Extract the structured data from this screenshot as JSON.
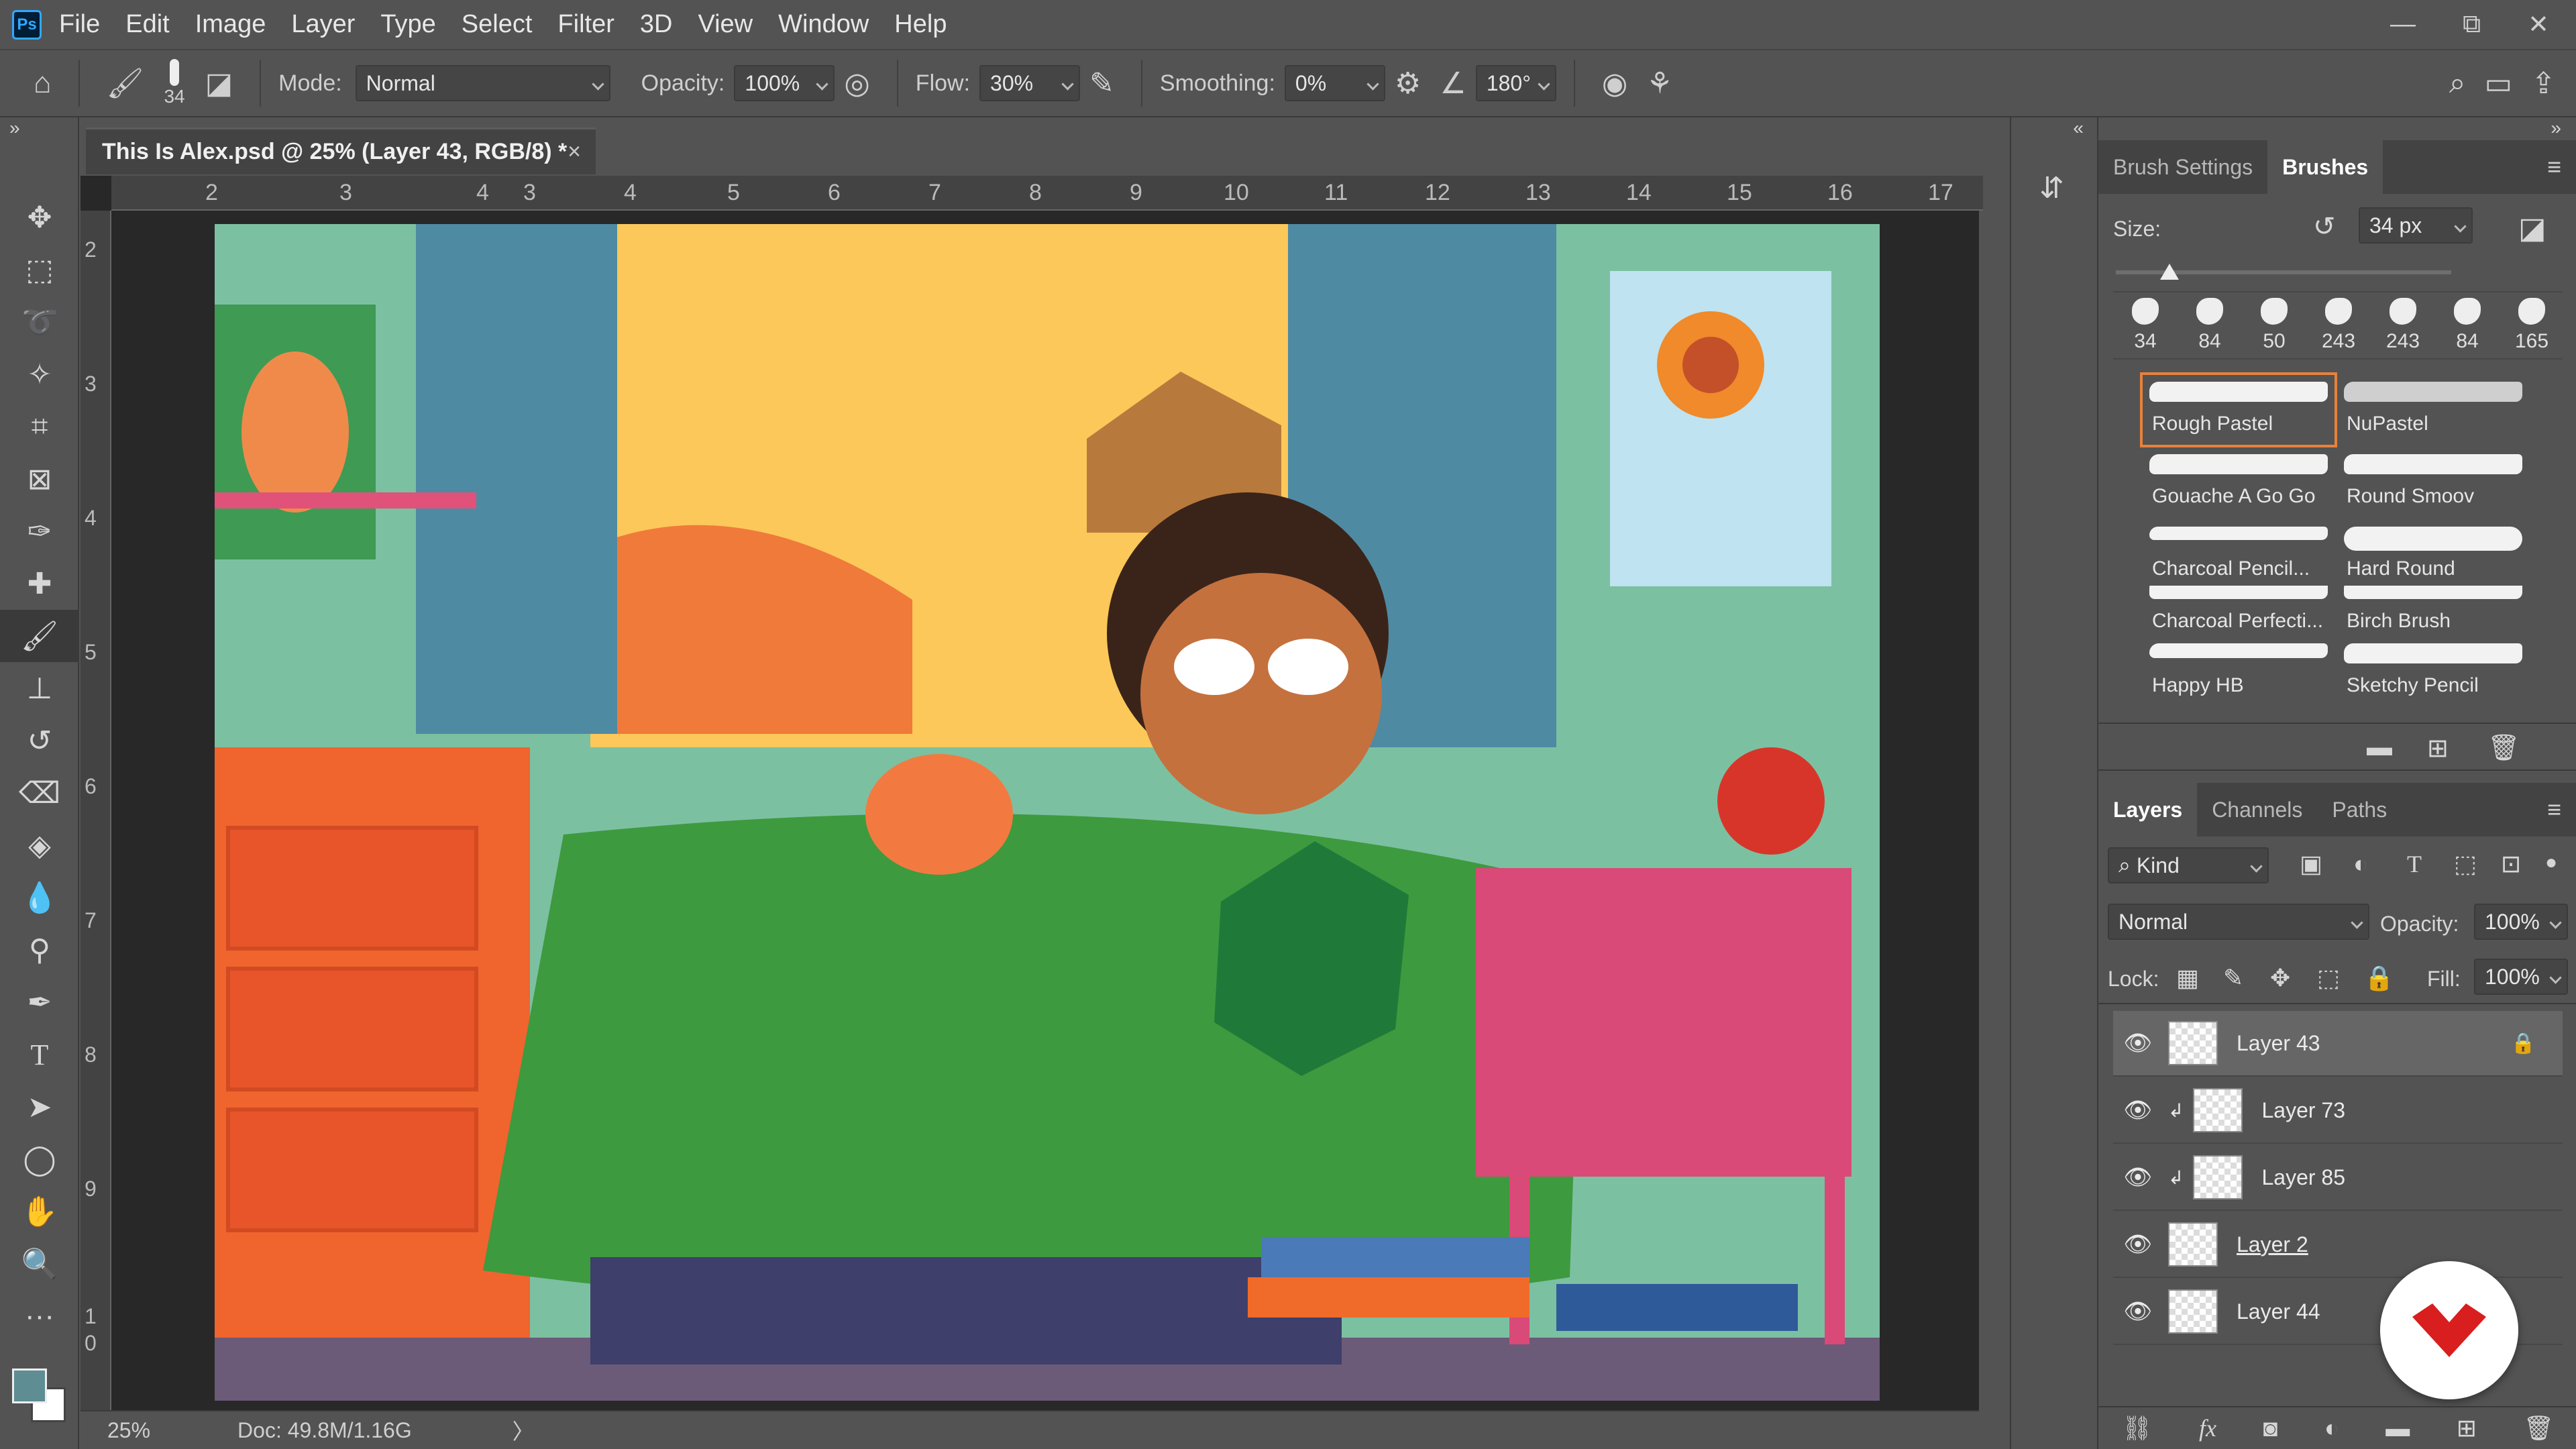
{
  "app": {
    "logo": "Ps",
    "menus": [
      "File",
      "Edit",
      "Image",
      "Layer",
      "Type",
      "Select",
      "Filter",
      "3D",
      "View",
      "Window",
      "Help"
    ]
  },
  "window_controls": {
    "minimize": "—",
    "restore": "⧉",
    "close": "✕"
  },
  "options_bar": {
    "brush_size": "34",
    "mode_label": "Mode:",
    "mode_value": "Normal",
    "opacity_label": "Opacity:",
    "opacity_value": "100%",
    "flow_label": "Flow:",
    "flow_value": "30%",
    "smoothing_label": "Smoothing:",
    "smoothing_value": "0%",
    "angle_value": "180°"
  },
  "document": {
    "tab_title": "This Is Alex.psd @ 25% (Layer 43, RGB/8) *",
    "close": "×"
  },
  "ruler": {
    "top_ticks": [
      "2",
      "3",
      "4",
      "3",
      "4",
      "5",
      "6",
      "7",
      "8",
      "9",
      "10",
      "11",
      "12",
      "13",
      "14",
      "15",
      "16",
      "17"
    ],
    "left_ticks": [
      "2",
      "3",
      "4",
      "5",
      "6",
      "7",
      "8",
      "9",
      "1",
      "0"
    ]
  },
  "status": {
    "zoom": "25%",
    "doc": "Doc: 49.8M/1.16G",
    "arrow": "〉"
  },
  "brush_panel": {
    "tabs": [
      "Brush Settings",
      "Brushes"
    ],
    "active_tab": "Brushes",
    "size_label": "Size:",
    "size_value": "34 px",
    "size_slider_fraction": 0.16,
    "presets": [
      "34",
      "84",
      "50",
      "243",
      "243",
      "84",
      "165"
    ],
    "brushes": [
      "Rough Pastel",
      "NuPastel",
      "Gouache A Go Go",
      "Round Smoov",
      "Charcoal Pencil...",
      "Hard Round",
      "Charcoal Perfecti...",
      "Birch Brush",
      "Happy HB",
      "Sketchy Pencil"
    ],
    "selected_brush": "Rough Pastel"
  },
  "layers_panel": {
    "tabs": [
      "Layers",
      "Channels",
      "Paths"
    ],
    "active_tab": "Layers",
    "kind_value": "Kind",
    "blend_value": "Normal",
    "opacity_label": "Opacity:",
    "opacity_value": "100%",
    "lock_label": "Lock:",
    "fill_label": "Fill:",
    "fill_value": "100%",
    "layers": [
      {
        "name": "Layer 43",
        "clipped": false,
        "locked": true
      },
      {
        "name": "Layer 73",
        "clipped": true,
        "locked": false
      },
      {
        "name": "Layer 85",
        "clipped": true,
        "locked": false
      },
      {
        "name": "Layer 2",
        "clipped": false,
        "locked": false
      },
      {
        "name": "Layer 44",
        "clipped": false,
        "locked": false
      }
    ],
    "footer_fx": "fx"
  },
  "colors": {
    "foreground": "#5e8d93",
    "background": "#ffffff",
    "accent_selection": "#e8813a"
  }
}
